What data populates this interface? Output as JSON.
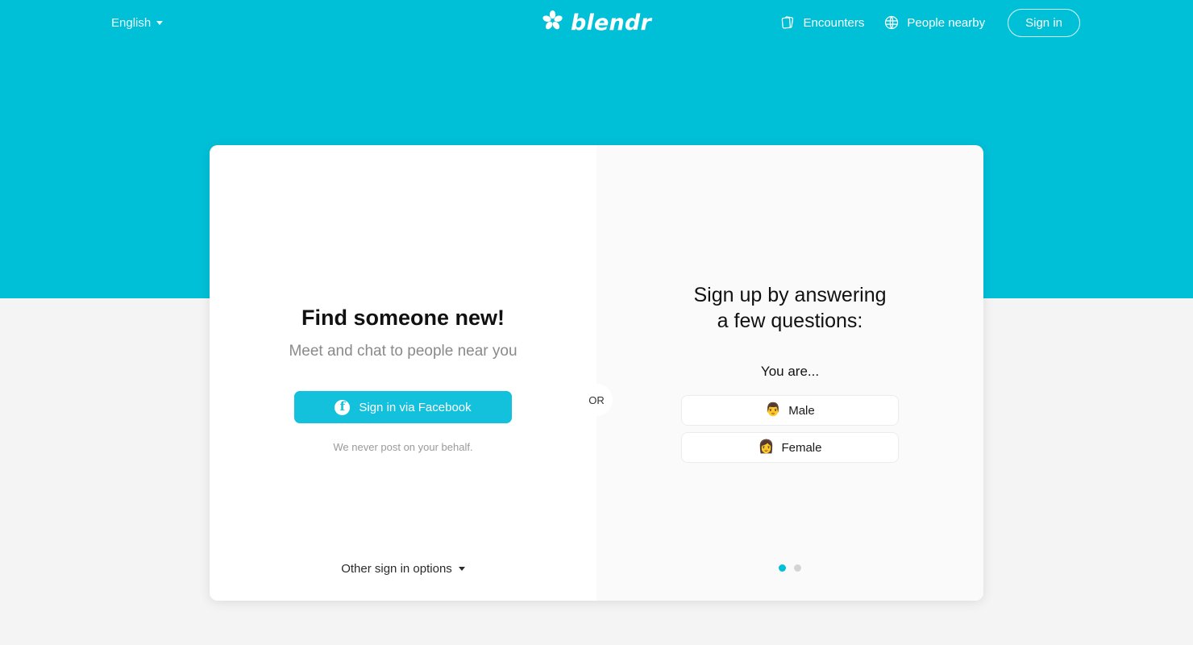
{
  "theme": {
    "brand_cyan": "#00c0d8",
    "button_cyan": "#13c1dd",
    "page_background": "#f4f4f4",
    "panel_left_bg": "#ffffff",
    "panel_right_bg": "#fafafa"
  },
  "header": {
    "language": {
      "label": "English",
      "caret_icon": "chevron-down-icon"
    },
    "brand": {
      "name": "blendr",
      "logo_icon": "pinwheel-flower-icon"
    },
    "nav": [
      {
        "label": "Encounters",
        "icon": "stacked-cards-icon"
      },
      {
        "label": "People nearby",
        "icon": "globe-icon"
      }
    ],
    "sign_in_label": "Sign in"
  },
  "divider": {
    "or_label": "OR"
  },
  "left_panel": {
    "headline": "Find someone new!",
    "subheadline": "Meet and chat to people near you",
    "facebook_button": {
      "label": "Sign in via Facebook",
      "icon": "facebook-icon",
      "glyph": "f"
    },
    "privacy_note": "We never post on your behalf.",
    "other_options": {
      "label": "Other sign in options",
      "caret_icon": "caret-down-icon"
    }
  },
  "right_panel": {
    "title_line_1": "Sign up by answering",
    "title_line_2": "a few questions:",
    "question": "You are...",
    "choices": [
      {
        "label": "Male",
        "emoji": "👨",
        "icon": "male-face-icon"
      },
      {
        "label": "Female",
        "emoji": "👩",
        "icon": "female-face-icon"
      }
    ],
    "pagination": {
      "total": 2,
      "active_index": 0
    }
  }
}
